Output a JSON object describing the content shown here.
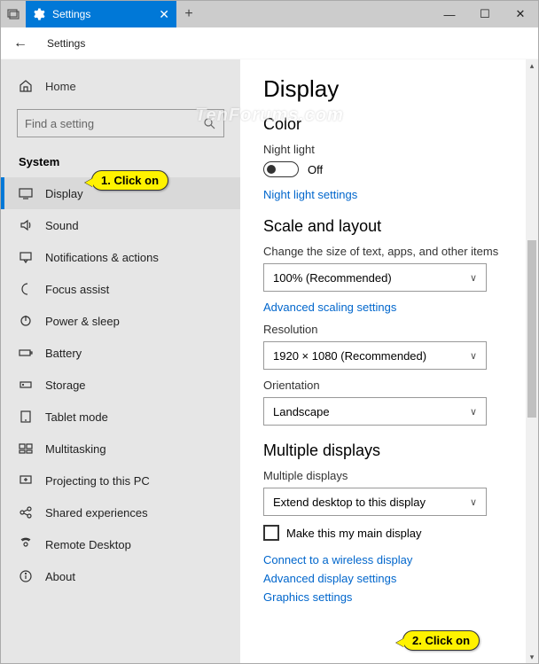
{
  "window": {
    "tab_title": "Settings",
    "new_tab": "+",
    "minimize": "—",
    "maximize": "☐",
    "close": "✕"
  },
  "header": {
    "back": "←",
    "breadcrumb": "Settings"
  },
  "sidebar": {
    "home": "Home",
    "search_placeholder": "Find a setting",
    "category": "System",
    "items": [
      {
        "label": "Display"
      },
      {
        "label": "Sound"
      },
      {
        "label": "Notifications & actions"
      },
      {
        "label": "Focus assist"
      },
      {
        "label": "Power & sleep"
      },
      {
        "label": "Battery"
      },
      {
        "label": "Storage"
      },
      {
        "label": "Tablet mode"
      },
      {
        "label": "Multitasking"
      },
      {
        "label": "Projecting to this PC"
      },
      {
        "label": "Shared experiences"
      },
      {
        "label": "Remote Desktop"
      },
      {
        "label": "About"
      }
    ]
  },
  "content": {
    "title": "Display",
    "color_section": "Color",
    "night_light_label": "Night light",
    "night_light_state": "Off",
    "night_light_link": "Night light settings",
    "scale_section": "Scale and layout",
    "scale_label": "Change the size of text, apps, and other items",
    "scale_value": "100% (Recommended)",
    "scaling_link": "Advanced scaling settings",
    "resolution_label": "Resolution",
    "resolution_value": "1920 × 1080 (Recommended)",
    "orientation_label": "Orientation",
    "orientation_value": "Landscape",
    "multiple_section": "Multiple displays",
    "multiple_label": "Multiple displays",
    "multiple_value": "Extend desktop to this display",
    "main_display_check": "Make this my main display",
    "wireless_link": "Connect to a wireless display",
    "adv_display_link": "Advanced display settings",
    "graphics_link": "Graphics settings"
  },
  "callouts": {
    "c1": "1. Click on",
    "c2": "2. Click on"
  },
  "watermark": "TenForums.com"
}
